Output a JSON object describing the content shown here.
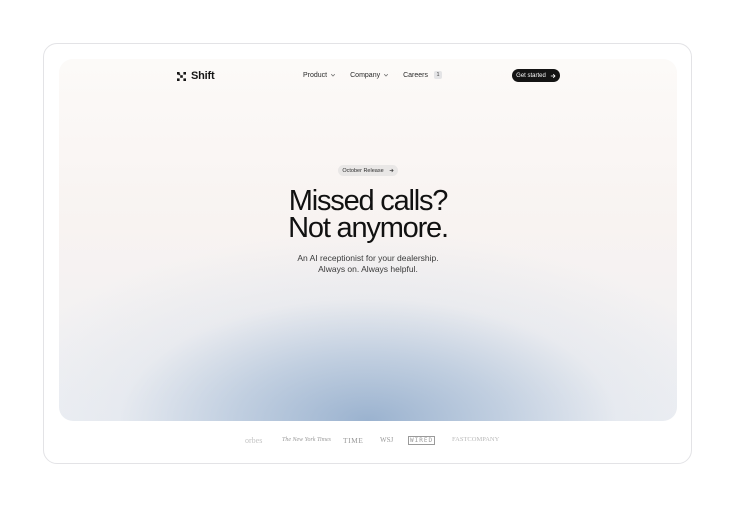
{
  "brand": {
    "name": "Shift",
    "logo_icon": "grid-diamond-icon"
  },
  "nav": {
    "items": [
      {
        "label": "Product",
        "has_dropdown": true
      },
      {
        "label": "Company",
        "has_dropdown": true
      },
      {
        "label": "Careers",
        "badge": "1"
      }
    ]
  },
  "cta": {
    "label": "Get started",
    "icon": "arrow-right-icon"
  },
  "hero": {
    "pill_label": "October Release",
    "pill_icon": "arrow-right-icon",
    "headline_line1": "Missed calls?",
    "headline_line2": "Not anymore.",
    "sub_line1": "An AI receptionist for your dealership.",
    "sub_line2": "Always on. Always helpful."
  },
  "press_logos": [
    "orbes",
    "The New York Times",
    "TIME",
    "WSJ",
    "WIRED",
    "FASTCOMPANY"
  ],
  "colors": {
    "accent_dark": "#141414",
    "gradient_blue": "#9fb4cd",
    "background": "#ffffff"
  }
}
